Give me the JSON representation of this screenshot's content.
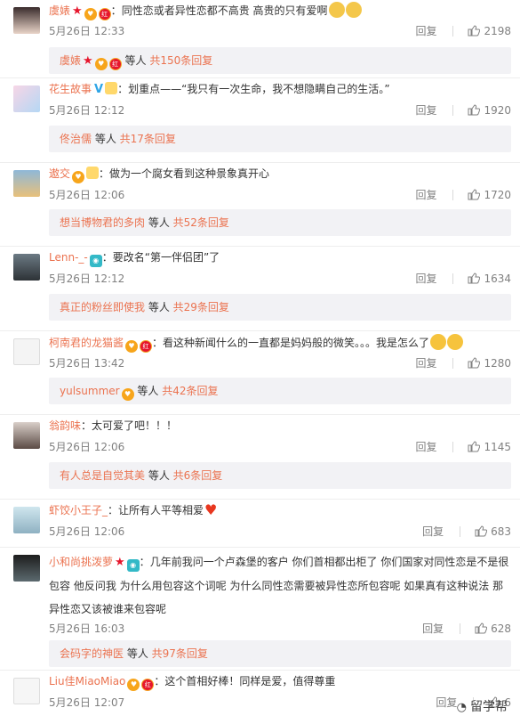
{
  "comments": [
    {
      "id": "c1",
      "user": "虞婊",
      "badges": [
        "star",
        "vip",
        "red"
      ],
      "colon": "：",
      "text": "同性恋或者异性恋都不高贵 高贵的只有爱啊",
      "emojis": [
        "cat",
        "cat"
      ],
      "time": "5月26日 12:33",
      "reply_label": "回复",
      "likes": "2198",
      "sub": {
        "names": "虞婊",
        "badges": [
          "star",
          "vip",
          "red"
        ],
        "mid": " 等人 ",
        "total": "共150条回复"
      }
    },
    {
      "id": "c2",
      "user": "花生故事",
      "badges": [
        "v",
        "emo"
      ],
      "colon": "：",
      "text": "划重点——“我只有一次生命，我不想隐瞒自己的生活。”",
      "time": "5月26日 12:12",
      "reply_label": "回复",
      "likes": "1920",
      "sub": {
        "names": "佟治儒",
        "badges": [],
        "mid": " 等人 ",
        "total": "共17条回复"
      }
    },
    {
      "id": "c3",
      "user": "遨交",
      "badges": [
        "vip",
        "emo"
      ],
      "colon": "：",
      "text": "做为一个腐女看到这种景象真开心",
      "time": "5月26日 12:06",
      "reply_label": "回复",
      "likes": "1720",
      "sub": {
        "names": "想当博物君的多肉",
        "badges": [],
        "mid": " 等人 ",
        "total": "共52条回复"
      }
    },
    {
      "id": "c4",
      "user": "Lenn-_-",
      "badges": [
        "cam"
      ],
      "colon": "：",
      "text": "要改名“第一伴侣团”了",
      "time": "5月26日 12:12",
      "reply_label": "回复",
      "likes": "1634",
      "sub": {
        "names": "真正的粉丝即使我",
        "badges": [],
        "mid": " 等人 ",
        "total": "共29条回复"
      }
    },
    {
      "id": "c5",
      "user": "柯南君的龙猫酱",
      "badges": [
        "vip",
        "red"
      ],
      "colon": "：",
      "text": "看这种新闻什么的一直都是妈妈般的微笑。。。我是怎么了",
      "emojis": [
        "laugh",
        "laugh"
      ],
      "time": "5月26日 13:42",
      "reply_label": "回复",
      "likes": "1280",
      "sub": {
        "names": "yulsummer",
        "badges": [
          "vip"
        ],
        "mid": " 等人 ",
        "total": "共42条回复"
      }
    },
    {
      "id": "c6",
      "user": "翁韵味",
      "badges": [],
      "colon": "：",
      "text": "太可爱了吧！！！",
      "time": "5月26日 12:06",
      "reply_label": "回复",
      "likes": "1145",
      "sub": {
        "names": "有人总是自觉其美",
        "badges": [],
        "mid": " 等人 ",
        "total": "共6条回复"
      }
    },
    {
      "id": "c7",
      "user": "虾饺小王子_",
      "badges": [],
      "colon": "：",
      "text": "让所有人平等相爱",
      "emojis": [
        "heart"
      ],
      "time": "5月26日 12:06",
      "reply_label": "回复",
      "likes": "683"
    },
    {
      "id": "c8",
      "user": "小和尚挑泼萝",
      "badges": [
        "star",
        "cam"
      ],
      "colon": "：",
      "text": "几年前我问一个卢森堡的客户   你们首相都出柜了   你们国家对同性恋是不是很包容   他反问我   为什么用包容这个词呢   为什么同性恋需要被异性恋所包容呢   如果真有这种说法 那异性恋又该被谁来包容呢",
      "time": "5月26日 16:03",
      "reply_label": "回复",
      "likes": "628",
      "sub": {
        "names": "会码字的神医",
        "badges": [],
        "mid": " 等人 ",
        "total": "共97条回复"
      }
    },
    {
      "id": "c9",
      "user": "Liu佳MiaoMiao",
      "badges": [
        "vip",
        "red"
      ],
      "colon": "：",
      "text": "这个首相好棒！同样是爱，值得尊重",
      "time": "5月26日 12:07",
      "reply_label": "回复",
      "likes": "6"
    }
  ],
  "colors": {
    "name": "#eb7350",
    "meta": "#808080",
    "sub_bg": "#f2f2f5",
    "divider": "#eeeeee"
  },
  "watermark": "留学帮"
}
